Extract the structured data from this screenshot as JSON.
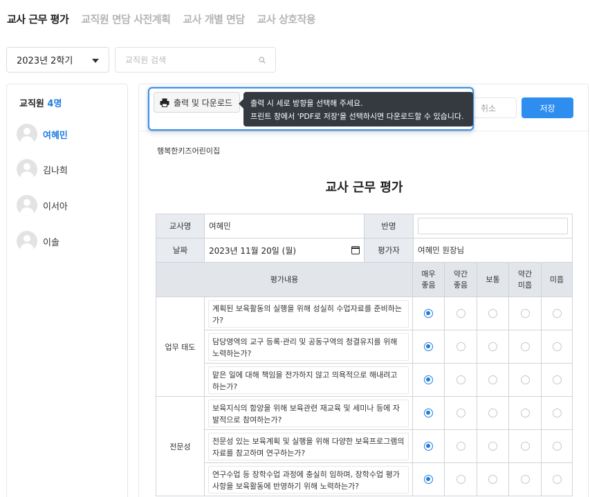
{
  "tabs": [
    {
      "label": "교사 근무 평가"
    },
    {
      "label": "교직원 면담 사전계획"
    },
    {
      "label": "교사 개별 면담"
    },
    {
      "label": "교사 상호작용"
    }
  ],
  "term_select": {
    "value": "2023년 2학기"
  },
  "search": {
    "placeholder": "교직원 검색"
  },
  "sidebar": {
    "title": "교직원",
    "count": "4명",
    "items": [
      {
        "name": "여혜민"
      },
      {
        "name": "김나희"
      },
      {
        "name": "이서아"
      },
      {
        "name": "이솔"
      }
    ]
  },
  "toolbar": {
    "print_label": "출력 및 다운로드",
    "tooltip_line1": "출력 시 세로 방향을 선택해 주세요.",
    "tooltip_line2": "프린트 창에서 'PDF로 저장'을 선택하시면 다운로드할 수 있습니다.",
    "cancel_label": "취소",
    "save_label": "저장"
  },
  "document": {
    "center_name": "행복한키즈어린이집",
    "title": "교사 근무 평가",
    "info": {
      "teacher_label": "교사명",
      "teacher_value": "여혜민",
      "class_label": "반명",
      "class_value": "",
      "date_label": "날짜",
      "date_value": "2023년 11월 20일 (월)",
      "evaluator_label": "평가자",
      "evaluator_value": "여혜민 원장님"
    },
    "eval_header": {
      "content": "평가내용",
      "levels": [
        "매우\n좋음",
        "약간\n좋음",
        "보통",
        "약간\n미흡",
        "미흡"
      ]
    },
    "categories": [
      {
        "name": "업무 태도",
        "questions": [
          {
            "text": "계획된 보육활동의 실행을 위해 성실히 수업자료를 준비하는가?",
            "selected": 0
          },
          {
            "text": "담당영역의 교구 등록·관리 및 공동구역의 청결유지를 위해 노력하는가?",
            "selected": 0
          },
          {
            "text": "맡은 일에 대해 책임을 전가하지 않고 의욕적으로 해내려고 하는가?",
            "selected": 0
          }
        ]
      },
      {
        "name": "전문성",
        "questions": [
          {
            "text": "보육지식의 함양을 위해 보육관련 재교육 및 세미나 등에 자발적으로 참여하는가?",
            "selected": 0
          },
          {
            "text": "전문성 있는 보육계획 및 실행을 위해 다양한 보육프로그램의 자료를 참고하며 연구하는가?",
            "selected": 0
          },
          {
            "text": "연구수업 등 장학수업 과정에 충실히 임하며, 장학수업 평가사항을 보육활동에 반영하기 위해 노력하는가?",
            "selected": 0
          }
        ]
      }
    ]
  },
  "colors": {
    "accent": "#1e7be0",
    "save_button": "#2d8ef0",
    "tooltip_bg": "#353a40",
    "highlight_border": "#3a8fe6"
  }
}
